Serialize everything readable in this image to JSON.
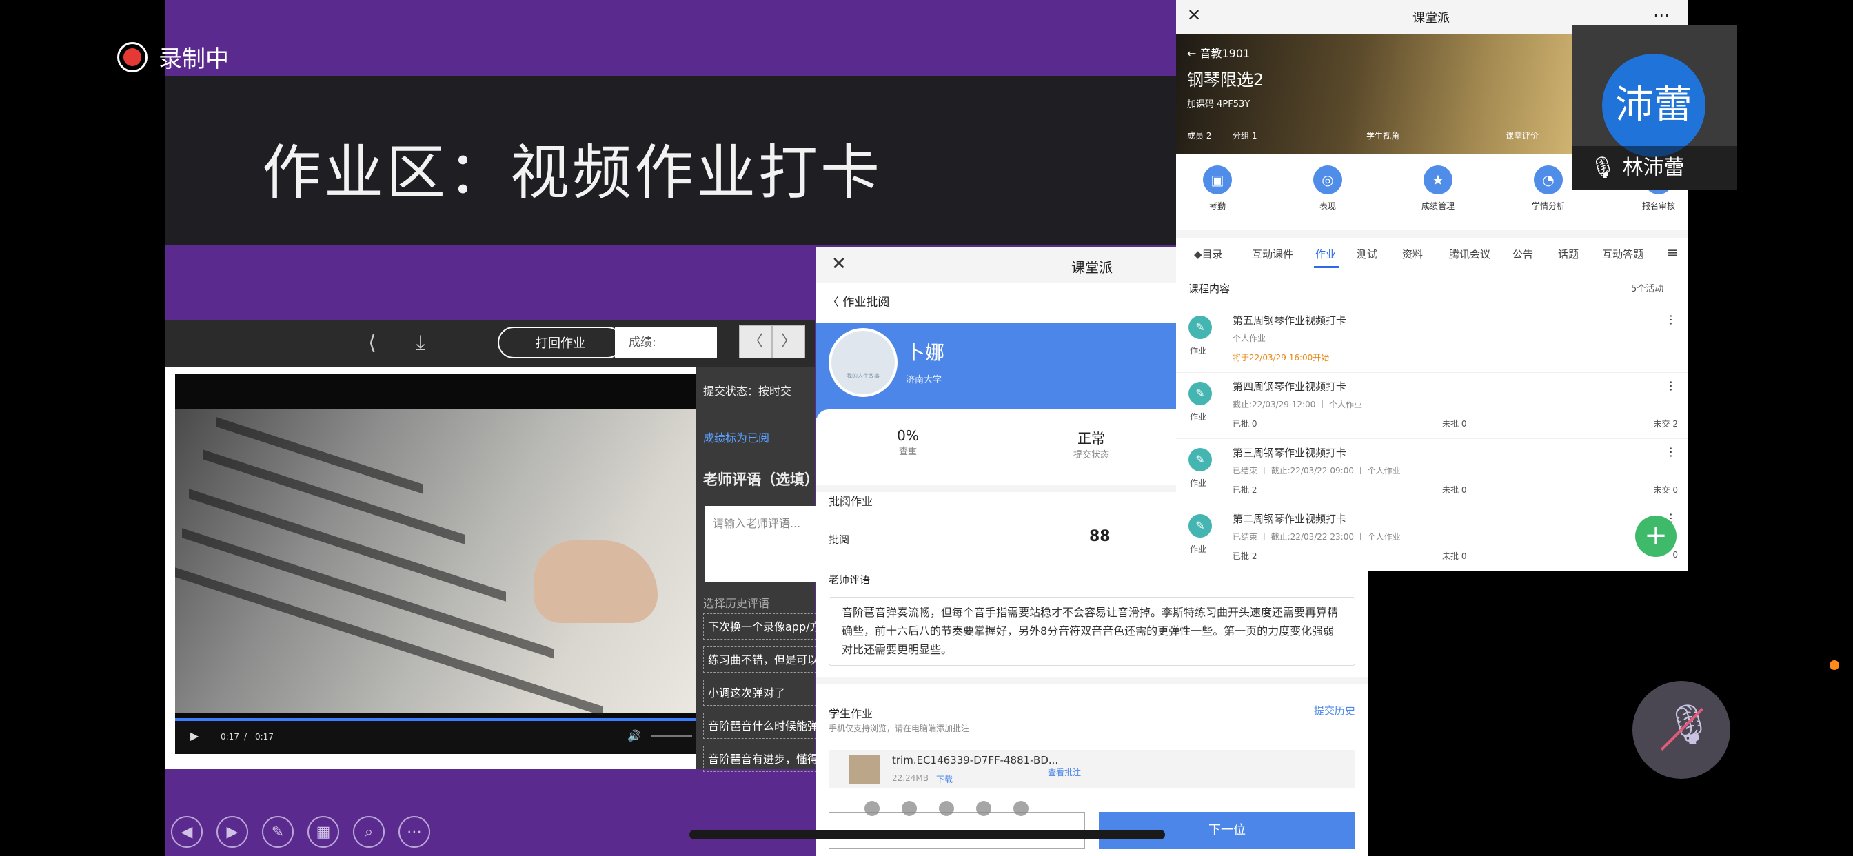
{
  "recording": {
    "label": "录制中"
  },
  "slide": {
    "title": "作业区：视频作业打卡"
  },
  "grade_toolbar": {
    "return_label": "打回作业",
    "score_placeholder": "成绩:",
    "prev": "〈",
    "next": "〉"
  },
  "video": {
    "time_current": "0:17",
    "time_sep": "/",
    "time_total": "0:17"
  },
  "grade_side": {
    "submit_status": "提交状态：按时交",
    "mark_done": "成绩标为已阅",
    "teacher_comment_title": "老师评语（选填）",
    "teacher_comment_placeholder": "请输入老师评语...",
    "history_title": "选择历史评语",
    "history": [
      "下次换一个录像app/方",
      "练习曲不错，但是可以",
      "小调这次弹对了",
      "音阶琶音什么时候能弹",
      "音阶琶音有进步，懂得"
    ]
  },
  "phone1": {
    "app_title": "课堂派",
    "back_label": "作业批阅",
    "student_name": "卜娜",
    "school": "济南大学",
    "avatar_caption": "我的人生故事",
    "stat_dup_value": "0%",
    "stat_dup_label": "查重",
    "stat_status_value": "正常",
    "stat_status_label": "提交状态",
    "review_section": "批阅作业",
    "review_label": "批阅",
    "score": "88",
    "comment_section": "老师评语",
    "comment": "音阶琶音弹奏流畅，但每个音手指需要站稳才不会容易让音滑掉。李斯特练习曲开头速度还需要再算精确些，前十六后八的节奏要掌握好，另外8分音符双音音色还需的更弹性一些。第一页的力度变化强弱对比还需要更明显些。",
    "student_work": "学生作业",
    "student_work_note": "手机仅支持浏览，请在电脑端添加批注",
    "submit_history": "提交历史",
    "file_name": "trim.EC146339-D7FF-4881-BD...",
    "file_size": "22.24MB",
    "download": "下载",
    "view_annotation": "查看批注",
    "next_button": "下一位"
  },
  "phone2": {
    "app_title": "课堂派",
    "class_name": "音教1901",
    "course_name": "钢琴限选2",
    "join_code": "加课码 4PF53Y",
    "members": "成员 2",
    "groups": "分组 1",
    "student_view": "学生视角",
    "course_eval": "课堂评价",
    "features": [
      {
        "label": "考勤",
        "icon": "calendar-icon"
      },
      {
        "label": "表现",
        "icon": "medal-icon"
      },
      {
        "label": "成绩管理",
        "icon": "star-icon"
      },
      {
        "label": "学情分析",
        "icon": "pie-chart-icon"
      },
      {
        "label": "报名审核",
        "icon": "check-icon"
      }
    ],
    "tabs": [
      "目录",
      "互动课件",
      "作业",
      "测试",
      "资料",
      "腾讯会议",
      "公告",
      "话题",
      "互动答题"
    ],
    "active_tab": "作业",
    "content_label": "课程内容",
    "activity_count": "5个活动",
    "homework": [
      {
        "title": "第五周钢琴作业视频打卡",
        "sub": "个人作业",
        "status": "将于22/03/29 16:00开始",
        "kind": "作业",
        "c1": "",
        "c2": "",
        "c3": ""
      },
      {
        "title": "第四周钢琴作业视频打卡",
        "sub": "截止:22/03/29 12:00 丨 个人作业",
        "status": "",
        "kind": "作业",
        "c1": "已批 0",
        "c2": "未批 0",
        "c3": "未交 2"
      },
      {
        "title": "第三周钢琴作业视频打卡",
        "sub": "已结束 丨 截止:22/03/22 09:00 丨 个人作业",
        "status": "",
        "kind": "作业",
        "c1": "已批 2",
        "c2": "未批 0",
        "c3": "未交 0"
      },
      {
        "title": "第二周钢琴作业视频打卡",
        "sub": "已结束 丨 截止:22/03/22 23:00 丨 个人作业",
        "status": "",
        "kind": "作业",
        "c1": "已批 2",
        "c2": "未批 0",
        "c3": "0"
      }
    ]
  },
  "participant": {
    "avatar_text": "沛蕾",
    "name": "林沛蕾"
  },
  "colors": {
    "slide_bg": "#5b2a8e",
    "accent_blue": "#4b86e8",
    "rec_red": "#e53935",
    "fab_green": "#3fba6a",
    "warning_orange": "#e88a1a"
  }
}
